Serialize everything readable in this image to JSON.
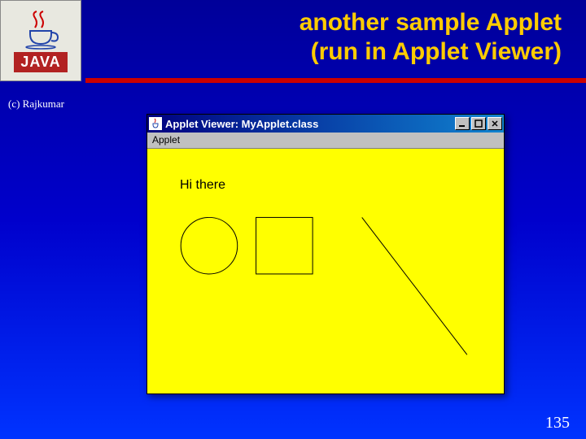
{
  "logo": {
    "text": "JAVA"
  },
  "title": {
    "line1": "another sample Applet",
    "line2": "(run in Applet  Viewer)"
  },
  "copyright": "(c)  Rajkumar",
  "slideNumber": "135",
  "window": {
    "title": "Applet Viewer: MyApplet.class",
    "menu": "Applet",
    "canvasText": "Hi there"
  }
}
